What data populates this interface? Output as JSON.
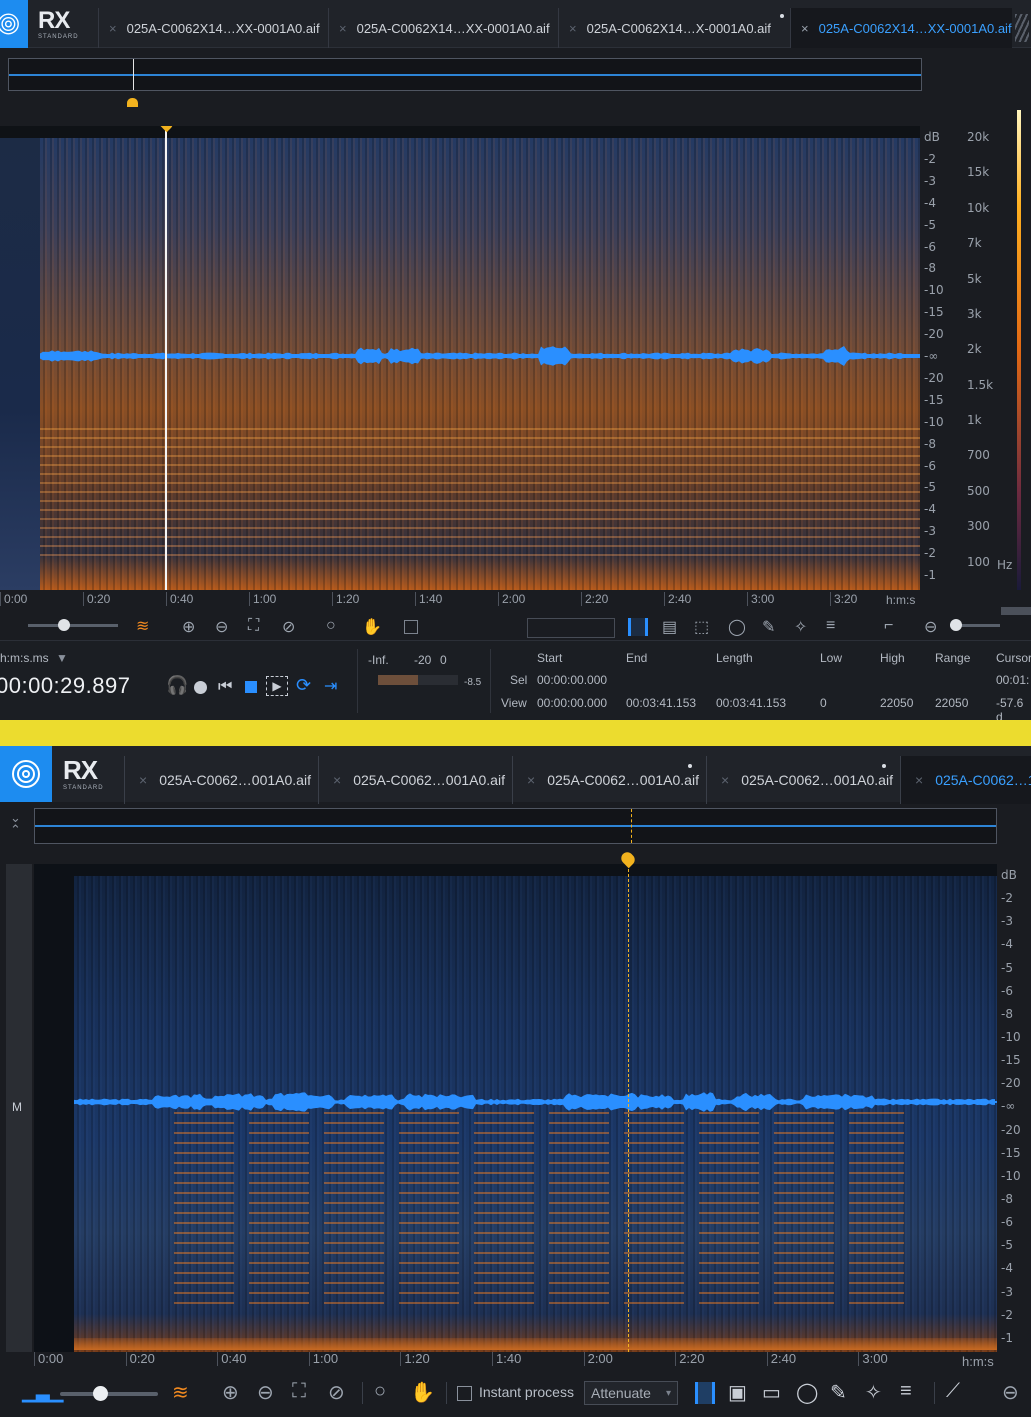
{
  "app": {
    "logo_text": "RX",
    "logo_sub": "STANDARD"
  },
  "top": {
    "tabs": [
      {
        "label": "025A-C0062X14…XX-0001A0.aif",
        "active": false,
        "modified": false
      },
      {
        "label": "025A-C0062X14…XX-0001A0.aif",
        "active": false,
        "modified": false
      },
      {
        "label": "025A-C0062X14…X-0001A0.aif",
        "active": false,
        "modified": true
      },
      {
        "label": "025A-C0062X14…XX-0001A0.aif",
        "active": true,
        "modified": false
      }
    ],
    "db_scale": [
      "dB",
      "-2",
      "-3",
      "-4",
      "-5",
      "-6",
      "-8",
      "-10",
      "-15",
      "-20",
      "-∞",
      "-20",
      "-15",
      "-10",
      "-8",
      "-6",
      "-5",
      "-4",
      "-3",
      "-2",
      "-1"
    ],
    "hz_scale": [
      "20k",
      "15k",
      "10k",
      "7k",
      "5k",
      "3k",
      "2k",
      "1.5k",
      "1k",
      "700",
      "500",
      "300",
      "100"
    ],
    "hz_unit": "Hz",
    "time_ticks": [
      "0:00",
      "0:20",
      "0:40",
      "1:00",
      "1:20",
      "1:40",
      "2:00",
      "2:20",
      "2:40",
      "3:00",
      "3:20"
    ],
    "time_unit": "h:m:s",
    "playhead_fraction": 0.142
  },
  "transport": {
    "time_format": "h:m:s.ms",
    "time_value": "00:00:29.897",
    "meter": {
      "labels": [
        "-Inf.",
        "-20",
        "0"
      ],
      "peak": "-8.5"
    },
    "selection": {
      "headers": [
        "Start",
        "End",
        "Length",
        "Low",
        "High",
        "Range",
        "Cursor"
      ],
      "sel_label": "Sel",
      "sel_start": "00:00:00.000",
      "view_label": "View",
      "view_start": "00:00:00.000",
      "view_end": "00:03:41.153",
      "view_length": "00:03:41.153",
      "low": "0",
      "high": "22050",
      "range": "22050",
      "cursor_time": "00:01:",
      "cursor_db": "-57.6 d"
    }
  },
  "bottom": {
    "tabs": [
      {
        "label": "025A-C0062…001A0.aif",
        "active": false,
        "modified": false
      },
      {
        "label": "025A-C0062…001A0.aif",
        "active": false,
        "modified": false
      },
      {
        "label": "025A-C0062…001A0.aif",
        "active": false,
        "modified": true
      },
      {
        "label": "025A-C0062…001A0.aif",
        "active": false,
        "modified": true
      },
      {
        "label": "025A-C0062…1",
        "active": true,
        "modified": false
      }
    ],
    "channel_label": "M",
    "db_scale": [
      "dB",
      "-2",
      "-3",
      "-4",
      "-5",
      "-6",
      "-8",
      "-10",
      "-15",
      "-20",
      "-∞",
      "-20",
      "-15",
      "-10",
      "-8",
      "-6",
      "-5",
      "-4",
      "-3",
      "-2",
      "-1"
    ],
    "time_ticks": [
      "0:00",
      "0:20",
      "0:40",
      "1:00",
      "1:20",
      "1:40",
      "2:00",
      "2:20",
      "2:40",
      "3:00"
    ],
    "time_unit": "h:m:s",
    "playhead_fraction": 0.6,
    "toolbar": {
      "instant_process": "Instant process",
      "attenuate": "Attenuate",
      "instant_checked": false
    }
  },
  "colors": {
    "accent": "#1d8cf0",
    "playhead": "#f2b21e",
    "orange": "#ff8a1f",
    "divider": "#ecdc2e"
  }
}
